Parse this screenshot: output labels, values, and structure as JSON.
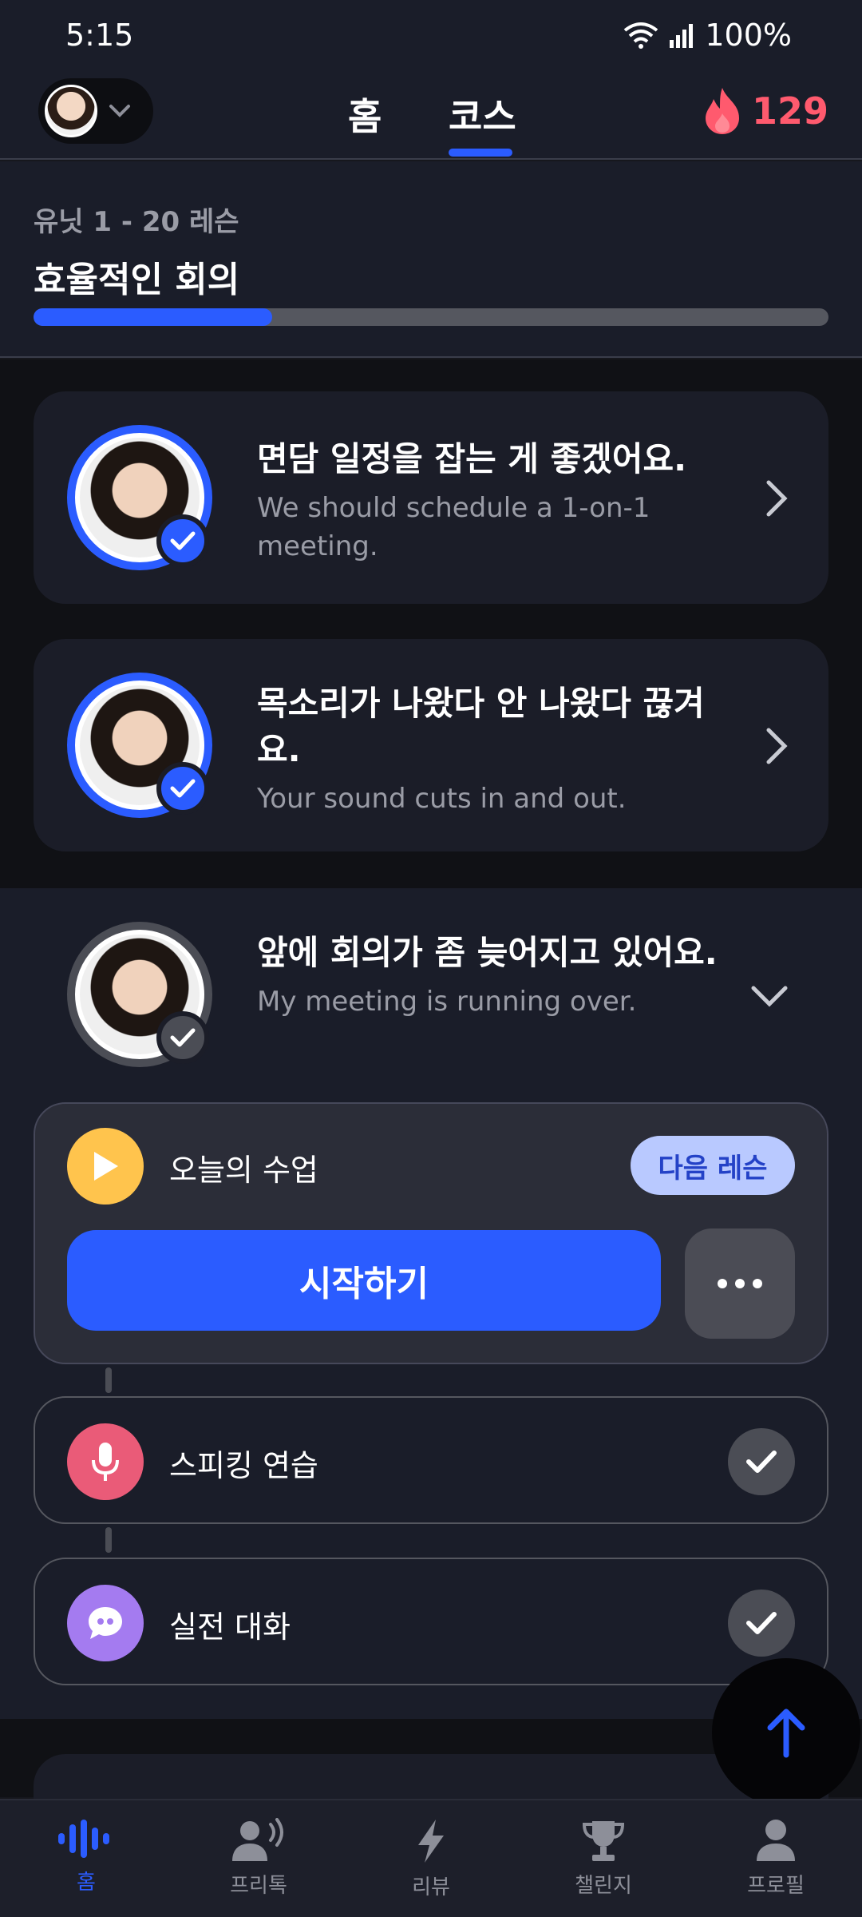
{
  "status_bar": {
    "time": "5:15",
    "battery": "100%"
  },
  "header": {
    "tabs": [
      {
        "label": "홈",
        "active": false
      },
      {
        "label": "코스",
        "active": true
      }
    ],
    "streak_count": "129",
    "accent": "#2b5cff"
  },
  "unit": {
    "subtitle": "유닛 1 - 20 레슨",
    "title": "효율적인 회의",
    "progress_fraction": 0.3
  },
  "lessons": [
    {
      "korean": "면담 일정을 잡는 게 좋겠어요.",
      "english": "We should schedule a 1-on-1 meeting.",
      "completed": true
    },
    {
      "korean": "목소리가 나왔다 안 나왔다 끊겨요.",
      "english": "Your sound cuts in and out.",
      "completed": true
    },
    {
      "korean": "앞에 회의가 좀 늦어지고 있어요.",
      "english": "My meeting is running over.",
      "completed": false,
      "expanded": true
    }
  ],
  "today_lesson": {
    "label": "오늘의 수업",
    "badge": "다음 레슨",
    "start_label": "시작하기"
  },
  "steps": [
    {
      "label": "스피킹 연습",
      "icon": "microphone-icon",
      "color": "#ea5b78",
      "done": true
    },
    {
      "label": "실전 대화",
      "icon": "chat-bubble-icon",
      "color": "#a47bf0",
      "done": true
    }
  ],
  "bottom_nav": [
    {
      "label": "홈",
      "icon": "waveform-icon",
      "active": true
    },
    {
      "label": "프리톡",
      "icon": "speaking-person-icon",
      "active": false
    },
    {
      "label": "리뷰",
      "icon": "lightning-icon",
      "active": false
    },
    {
      "label": "챌린지",
      "icon": "trophy-icon",
      "active": false
    },
    {
      "label": "프로필",
      "icon": "person-icon",
      "active": false
    }
  ]
}
